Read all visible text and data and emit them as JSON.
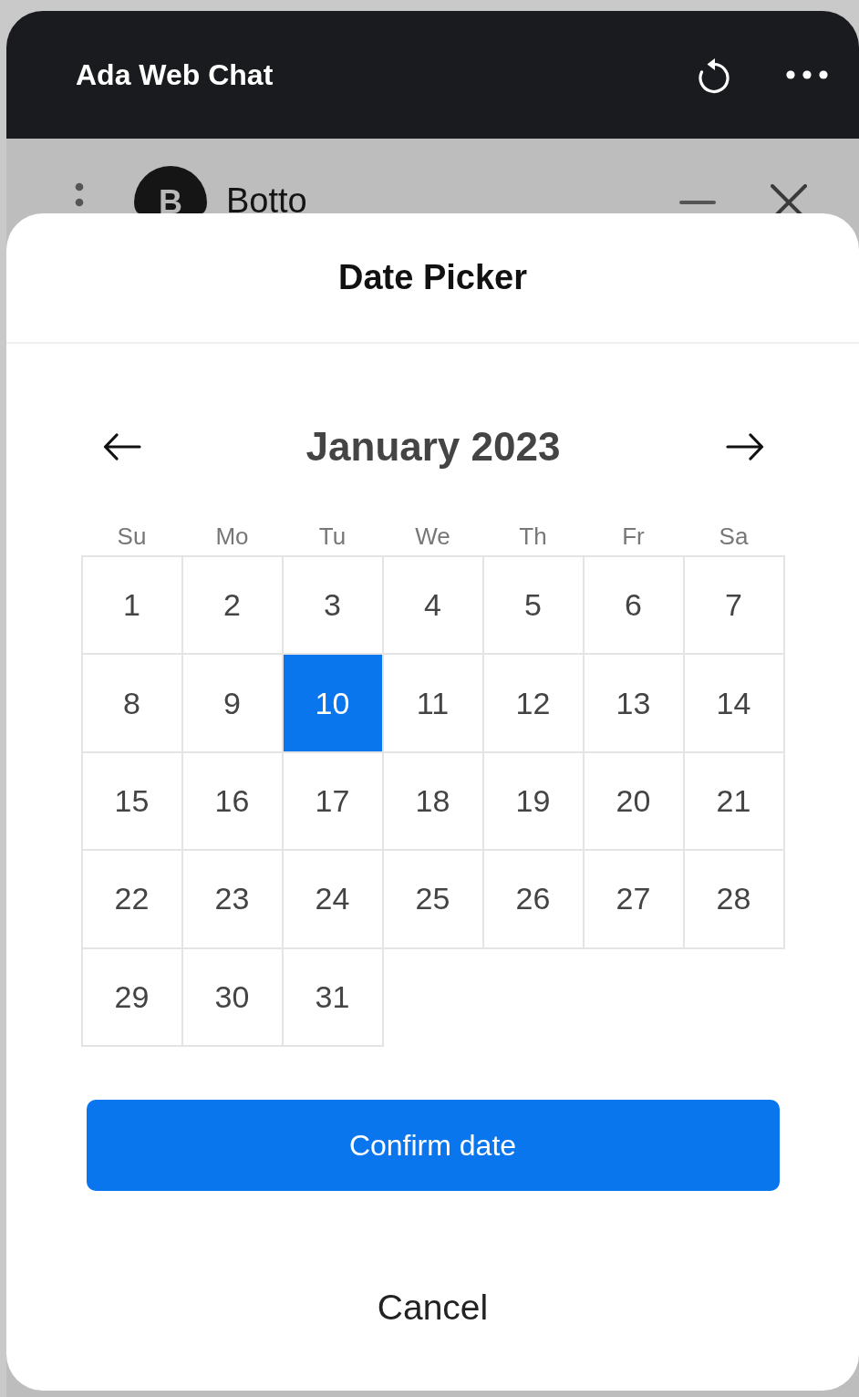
{
  "window": {
    "title": "Ada Web Chat"
  },
  "chat_header": {
    "avatar_initial": "B",
    "name": "Botto"
  },
  "date_picker": {
    "title": "Date Picker",
    "month": "January 2023",
    "weekdays": [
      "Su",
      "Mo",
      "Tu",
      "We",
      "Th",
      "Fr",
      "Sa"
    ],
    "days": [
      {
        "label": "1",
        "selected": false
      },
      {
        "label": "2",
        "selected": false
      },
      {
        "label": "3",
        "selected": false
      },
      {
        "label": "4",
        "selected": false
      },
      {
        "label": "5",
        "selected": false
      },
      {
        "label": "6",
        "selected": false
      },
      {
        "label": "7",
        "selected": false
      },
      {
        "label": "8",
        "selected": false
      },
      {
        "label": "9",
        "selected": false
      },
      {
        "label": "10",
        "selected": true
      },
      {
        "label": "11",
        "selected": false
      },
      {
        "label": "12",
        "selected": false
      },
      {
        "label": "13",
        "selected": false
      },
      {
        "label": "14",
        "selected": false
      },
      {
        "label": "15",
        "selected": false
      },
      {
        "label": "16",
        "selected": false
      },
      {
        "label": "17",
        "selected": false
      },
      {
        "label": "18",
        "selected": false
      },
      {
        "label": "19",
        "selected": false
      },
      {
        "label": "20",
        "selected": false
      },
      {
        "label": "21",
        "selected": false
      },
      {
        "label": "22",
        "selected": false
      },
      {
        "label": "23",
        "selected": false
      },
      {
        "label": "24",
        "selected": false
      },
      {
        "label": "25",
        "selected": false
      },
      {
        "label": "26",
        "selected": false
      },
      {
        "label": "27",
        "selected": false
      },
      {
        "label": "28",
        "selected": false
      },
      {
        "label": "29",
        "selected": false
      },
      {
        "label": "30",
        "selected": false
      },
      {
        "label": "31",
        "selected": false
      }
    ],
    "confirm_button": "Confirm date",
    "cancel_button": "Cancel"
  }
}
